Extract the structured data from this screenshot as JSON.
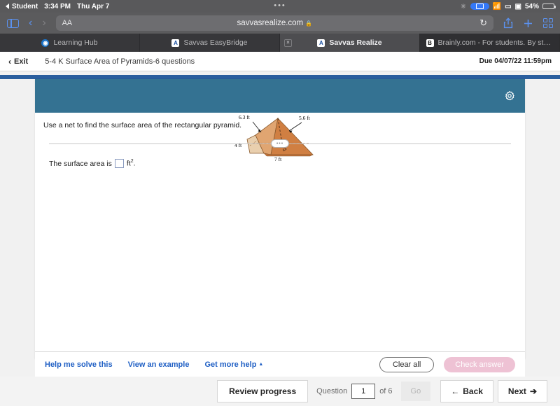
{
  "status_bar": {
    "back_app": "Student",
    "time": "3:34 PM",
    "date": "Thu Apr 7",
    "battery_percent": "54%",
    "center_dots": "•••"
  },
  "browser": {
    "text_size_label": "AA",
    "url": "savvasrealize.com",
    "lock_glyph": "🔒",
    "reload_glyph": "↻",
    "tabs": [
      {
        "label": "Learning Hub",
        "favicon_text": "◉",
        "active": false,
        "has_close": false
      },
      {
        "label": "Savvas EasyBridge",
        "favicon_text": "A",
        "active": false,
        "has_close": false
      },
      {
        "label": "Savvas Realize",
        "favicon_text": "A",
        "active": true,
        "has_close": true
      },
      {
        "label": "Brainly.com - For students. By stu...",
        "favicon_text": "B",
        "active": false,
        "has_close": false
      }
    ],
    "close_glyph": "×"
  },
  "assignment": {
    "exit_label": "Exit",
    "exit_chevron": "‹",
    "title": "5-4 K Surface Area of Pyramids-6 questions",
    "due": "Due 04/07/22 11:59pm"
  },
  "question": {
    "prompt": "Use a net to find the surface area of the rectangular pyramid.",
    "answer_prefix": "The surface area is",
    "answer_unit": "ft",
    "answer_exponent": "2",
    "answer_suffix": ".",
    "answer_value": "",
    "grip_dots": "•••",
    "figure": {
      "labels": {
        "slant_left": "6.3 ft",
        "slant_right": "5.6 ft",
        "width": "4 ft",
        "length": "7 ft"
      },
      "colors": {
        "face_dark": "#cf7b3f",
        "face_mid": "#d98a50",
        "face_light": "#e7c7a4",
        "outline": "#7d4a24"
      }
    }
  },
  "help_bar": {
    "links": [
      {
        "label": "Help me solve this",
        "caret": ""
      },
      {
        "label": "View an example",
        "caret": ""
      },
      {
        "label": "Get more help",
        "caret": "▲"
      }
    ],
    "clear_label": "Clear all",
    "check_label": "Check answer"
  },
  "bottom_bar": {
    "review_label": "Review progress",
    "question_label": "Question",
    "question_value": "1",
    "of_label": "of 6",
    "go_label": "Go",
    "back_label": "Back",
    "back_arrow": "←",
    "next_label": "Next",
    "next_arrow": "➔"
  },
  "colors": {
    "teal_header": "#347292",
    "navy_strip": "#2a5e9e",
    "link_blue": "#1f5fc4",
    "check_pink": "#eec2d4"
  }
}
